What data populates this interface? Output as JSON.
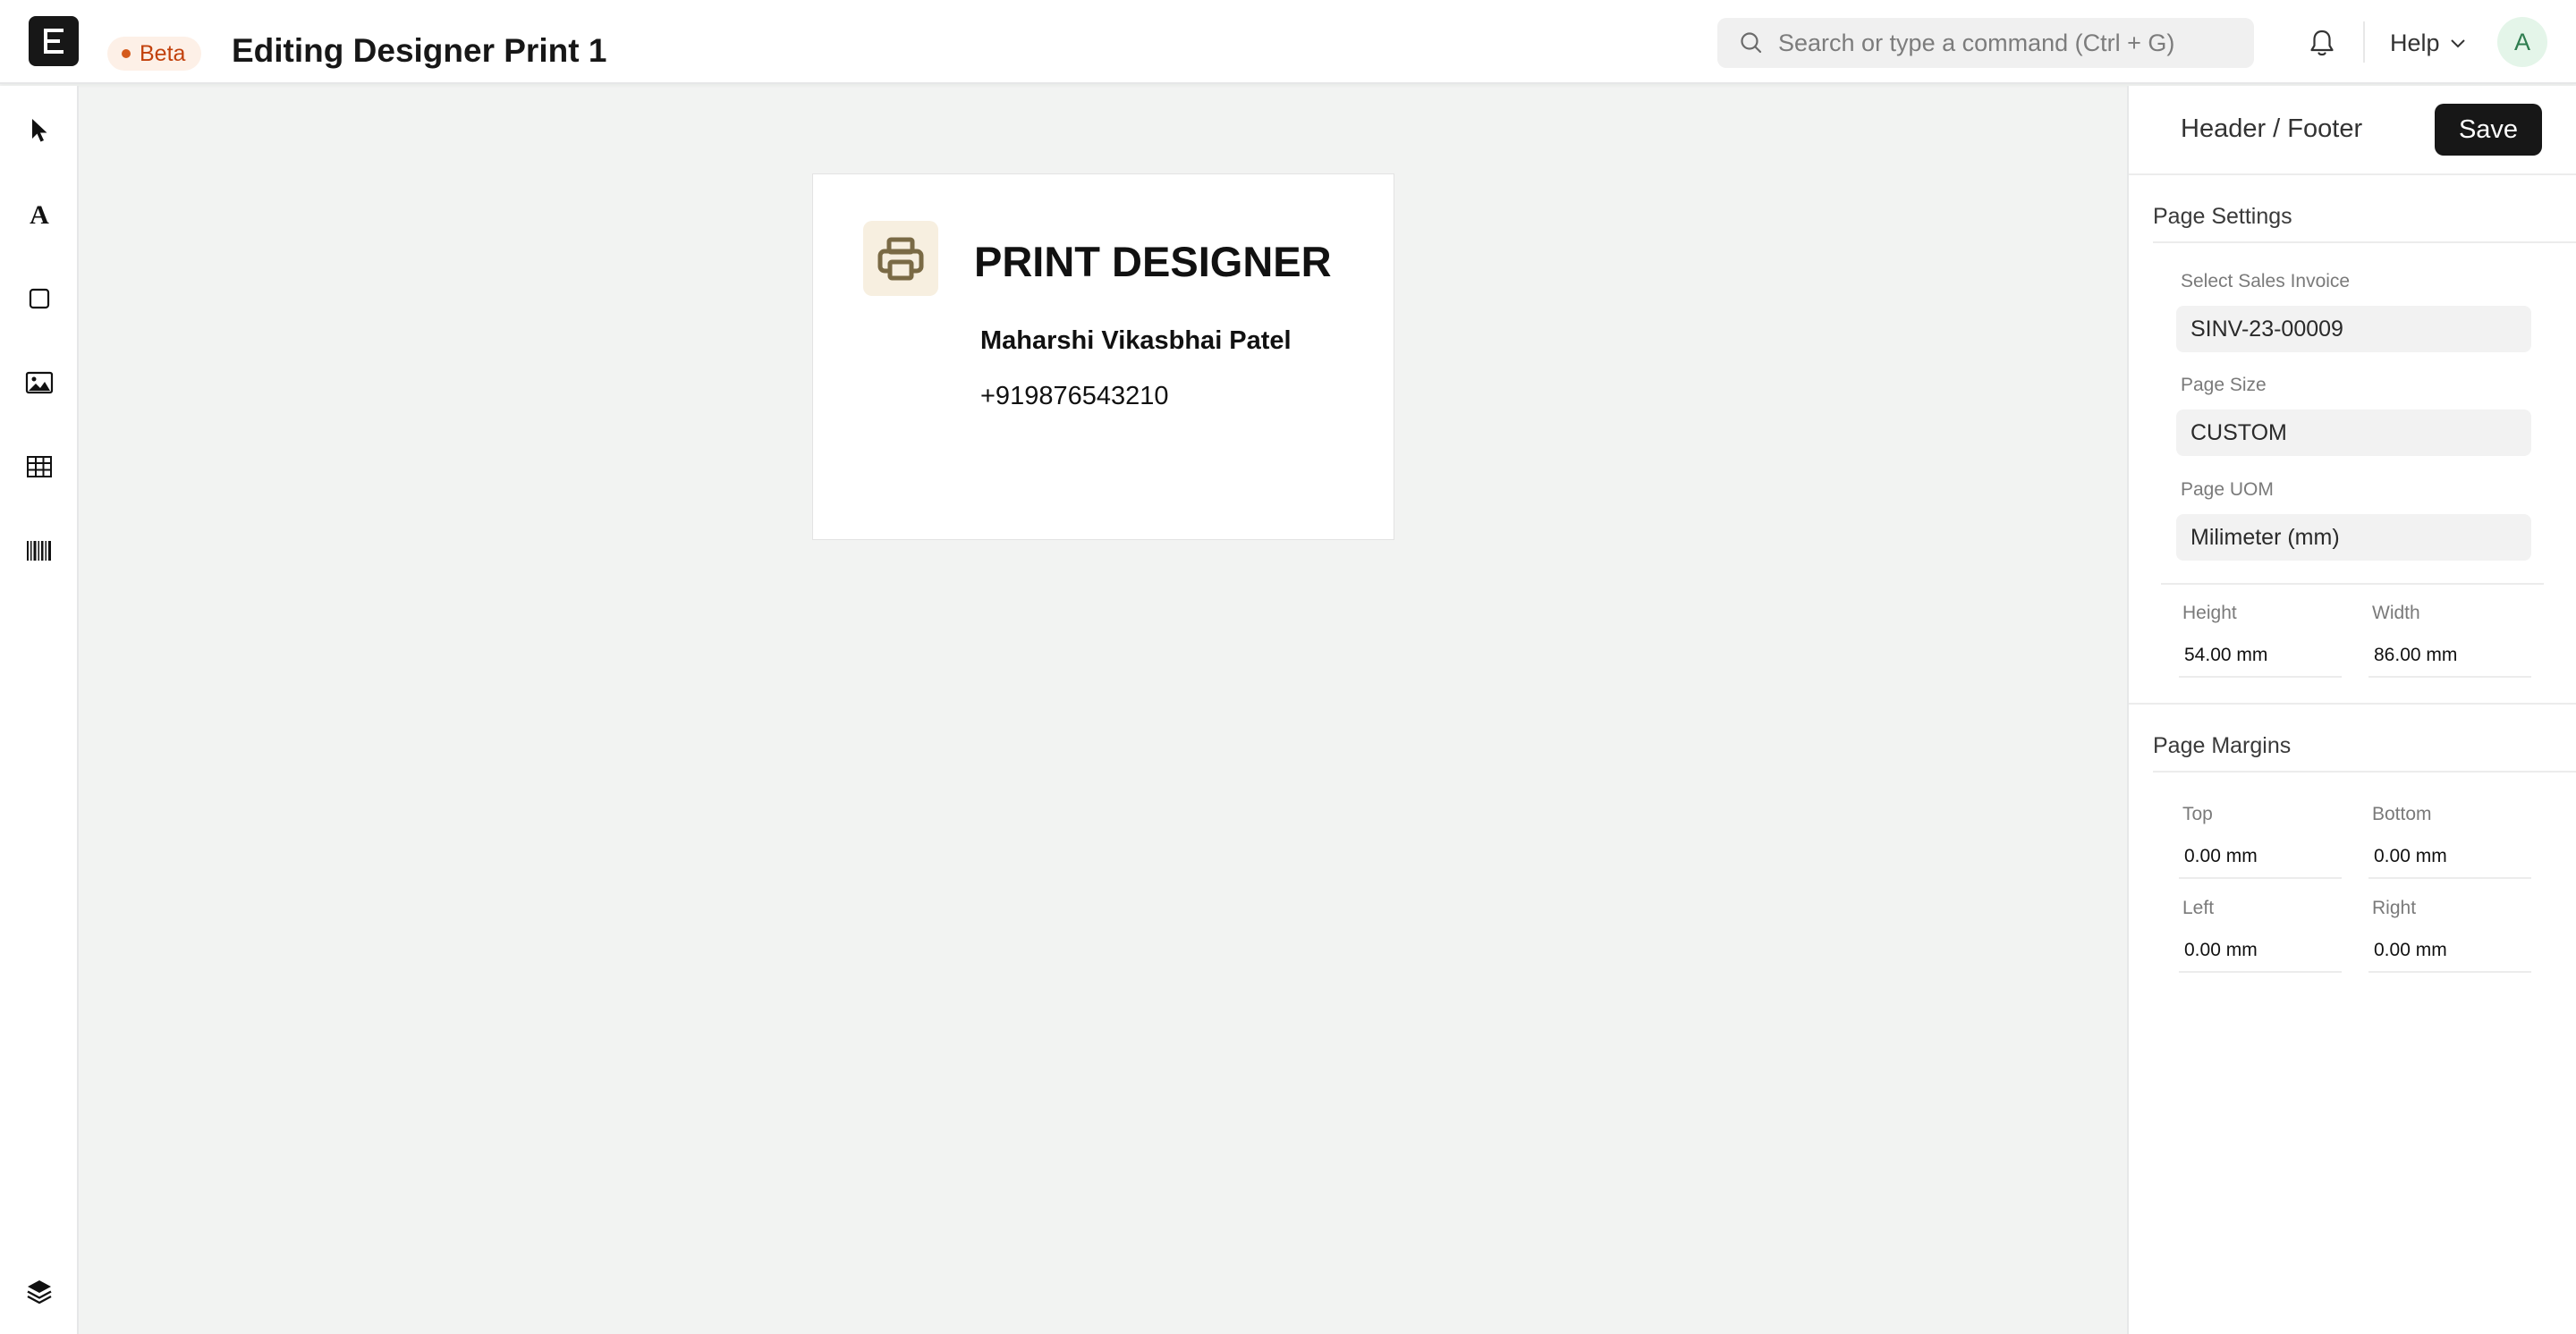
{
  "header": {
    "beta_label": "Beta",
    "title": "Editing Designer Print 1",
    "search_placeholder": "Search or type a command (Ctrl + G)",
    "help_label": "Help",
    "avatar_initial": "A"
  },
  "tools": [
    {
      "name": "select-tool",
      "icon": "cursor-icon"
    },
    {
      "name": "text-tool",
      "icon": "text-icon"
    },
    {
      "name": "rectangle-tool",
      "icon": "rectangle-icon"
    },
    {
      "name": "image-tool",
      "icon": "image-icon"
    },
    {
      "name": "table-tool",
      "icon": "table-icon"
    },
    {
      "name": "barcode-tool",
      "icon": "barcode-icon"
    },
    {
      "name": "layers-tool",
      "icon": "layers-icon"
    }
  ],
  "canvas": {
    "card_title": "PRINT DESIGNER",
    "card_name": "Maharshi Vikasbhai Patel",
    "card_phone": "+919876543210"
  },
  "panel": {
    "tab_label": "Header / Footer",
    "save_label": "Save",
    "page_settings": {
      "title": "Page Settings",
      "sales_invoice_label": "Select Sales Invoice",
      "sales_invoice_value": "SINV-23-00009",
      "page_size_label": "Page Size",
      "page_size_value": "CUSTOM",
      "page_uom_label": "Page UOM",
      "page_uom_value": "Milimeter (mm)",
      "height_label": "Height",
      "height_value": "54.00 mm",
      "width_label": "Width",
      "width_value": "86.00 mm"
    },
    "page_margins": {
      "title": "Page Margins",
      "top_label": "Top",
      "top_value": "0.00 mm",
      "bottom_label": "Bottom",
      "bottom_value": "0.00 mm",
      "left_label": "Left",
      "left_value": "0.00 mm",
      "right_label": "Right",
      "right_value": "0.00 mm"
    }
  },
  "colors": {
    "accent_dark": "#171717",
    "beta_text": "#c2410c",
    "beta_bg": "#fdf0e7",
    "canvas_bg": "#f2f3f2",
    "card_logo_bg": "#f7efe0",
    "card_logo_icon": "#7a6a45",
    "avatar_bg": "#e4f5e9"
  }
}
